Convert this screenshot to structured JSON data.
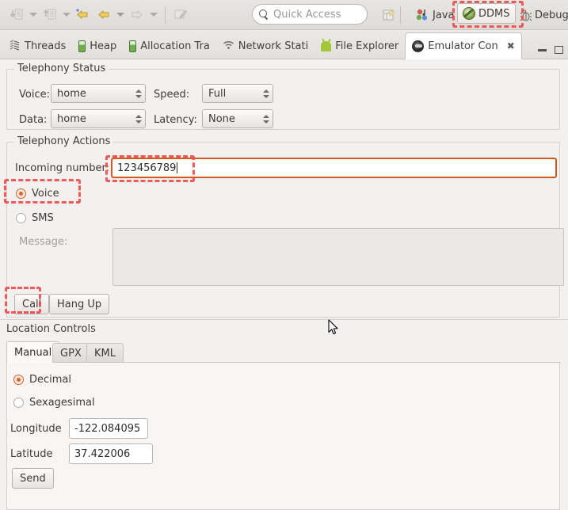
{
  "window": {
    "title": "DDMS - Emulator Control"
  },
  "toolbar": {
    "quick_access_placeholder": "Quick Access",
    "icons": [
      {
        "name": "import-icon",
        "glyph": "⤓"
      },
      {
        "name": "export-icon",
        "glyph": "⤒"
      },
      {
        "name": "back-arrow-icon",
        "glyph": "⇦"
      },
      {
        "name": "forward-arrow-icon",
        "glyph": "⇨"
      },
      {
        "name": "new-editor-icon",
        "glyph": "✎"
      }
    ],
    "perspectives": [
      {
        "name": "perspective-java",
        "label": "Java",
        "selected": false
      },
      {
        "name": "perspective-ddms",
        "label": "DDMS",
        "selected": true
      },
      {
        "name": "perspective-debug",
        "label": "Debug",
        "selected": false
      }
    ],
    "open_perspective_label": ""
  },
  "view_tabs": [
    {
      "label": "Threads",
      "icon": "threads-icon",
      "selected": false
    },
    {
      "label": "Heap",
      "icon": "heap-icon",
      "selected": false
    },
    {
      "label": "Allocation Tra",
      "icon": "allocation-tracker-icon",
      "selected": false
    },
    {
      "label": "Network Stati",
      "icon": "network-statistics-icon",
      "selected": false
    },
    {
      "label": "File Explorer",
      "icon": "file-explorer-icon",
      "selected": false
    },
    {
      "label": "Emulator Con",
      "icon": "emulator-control-icon",
      "selected": true
    }
  ],
  "view_tab_close": "✖",
  "telephony_status": {
    "title": "Telephony Status",
    "voice_label": "Voice:",
    "voice_value": "home",
    "speed_label": "Speed:",
    "speed_value": "Full",
    "data_label": "Data:",
    "data_value": "home",
    "latency_label": "Latency:",
    "latency_value": "None"
  },
  "telephony_actions": {
    "title": "Telephony Actions",
    "incoming_number_label": "Incoming number:",
    "incoming_number_value": "123456789",
    "voice_label": "Voice",
    "voice_selected": true,
    "sms_label": "SMS",
    "sms_selected": false,
    "message_label": "Message:",
    "message_value": "",
    "call_button": "Call",
    "hangup_button": "Hang Up"
  },
  "location_controls": {
    "title": "Location Controls",
    "tabs": [
      {
        "label": "Manual",
        "selected": true
      },
      {
        "label": "GPX",
        "selected": false
      },
      {
        "label": "KML",
        "selected": false
      }
    ],
    "decimal_label": "Decimal",
    "decimal_selected": true,
    "sexagesimal_label": "Sexagesimal",
    "sexagesimal_selected": false,
    "longitude_label": "Longitude",
    "longitude_value": "-122.084095",
    "latitude_label": "Latitude",
    "latitude_value": "37.422006",
    "send_button": "Send"
  },
  "annotations": {
    "color": "#ef4d4d",
    "highlighted": [
      "perspective-ddms",
      "incoming-number-input",
      "voice-radio-row",
      "call-button"
    ]
  },
  "colors": {
    "background": "#f2f1f0",
    "accent_focus": "#d05a22",
    "radio_selected": "#d3662c",
    "annotation_red": "#ef4d4d"
  }
}
